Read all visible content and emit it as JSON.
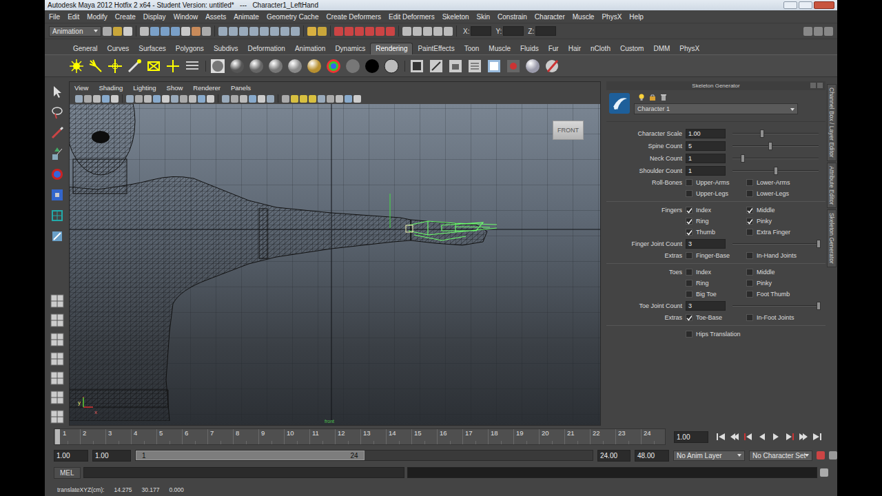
{
  "window": {
    "title": "Autodesk Maya 2012 Hotfix 2 x64 - Student Version: untitled*   ---   Character1_LeftHand"
  },
  "menu": [
    "File",
    "Edit",
    "Modify",
    "Create",
    "Display",
    "Window",
    "Assets",
    "Animate",
    "Geometry Cache",
    "Create Deformers",
    "Edit Deformers",
    "Skeleton",
    "Skin",
    "Constrain",
    "Character",
    "Muscle",
    "PhysX",
    "Help"
  ],
  "status_line": {
    "mode": "Animation",
    "coords": [
      "X:",
      "Y:",
      "Z:"
    ]
  },
  "shelf": {
    "tabs": [
      {
        "label": "General",
        "selected": false
      },
      {
        "label": "Curves",
        "selected": false
      },
      {
        "label": "Surfaces",
        "selected": false
      },
      {
        "label": "Polygons",
        "selected": false
      },
      {
        "label": "Subdivs",
        "selected": false
      },
      {
        "label": "Deformation",
        "selected": false
      },
      {
        "label": "Animation",
        "selected": false
      },
      {
        "label": "Dynamics",
        "selected": false
      },
      {
        "label": "Rendering",
        "selected": true
      },
      {
        "label": "PaintEffects",
        "selected": false
      },
      {
        "label": "Toon",
        "selected": false
      },
      {
        "label": "Muscle",
        "selected": false
      },
      {
        "label": "Fluids",
        "selected": false
      },
      {
        "label": "Fur",
        "selected": false
      },
      {
        "label": "Hair",
        "selected": false
      },
      {
        "label": "nCloth",
        "selected": false
      },
      {
        "label": "Custom",
        "selected": false
      },
      {
        "label": "DMM",
        "selected": false
      },
      {
        "label": "PhysX",
        "selected": false
      }
    ]
  },
  "viewport": {
    "menu": [
      "View",
      "Shading",
      "Lighting",
      "Show",
      "Renderer",
      "Panels"
    ],
    "view_cube": "FRONT",
    "camera": "front",
    "axis_labels": [
      "y",
      "x"
    ]
  },
  "skeleton_generator": {
    "title": "Skeleton Generator",
    "character": "Character 1",
    "rows": [
      {
        "kind": "slider",
        "label": "Character Scale",
        "value": "1.00",
        "level": 0.34
      },
      {
        "kind": "slider",
        "label": "Spine Count",
        "value": "5",
        "level": 0.44
      },
      {
        "kind": "slider",
        "label": "Neck Count",
        "value": "1",
        "level": 0.12
      },
      {
        "kind": "slider",
        "label": "Shoulder Count",
        "value": "1",
        "level": 0.5
      },
      {
        "kind": "checks",
        "label": "Roll-Bones",
        "items": [
          {
            "label": "Upper-Arms",
            "checked": false
          },
          {
            "label": "Lower-Arms",
            "checked": false
          }
        ]
      },
      {
        "kind": "checks",
        "label": "",
        "items": [
          {
            "label": "Upper-Legs",
            "checked": false
          },
          {
            "label": "Lower-Legs",
            "checked": false
          }
        ]
      },
      {
        "kind": "separator"
      },
      {
        "kind": "checks",
        "label": "Fingers",
        "items": [
          {
            "label": "Index",
            "checked": true
          },
          {
            "label": "Middle",
            "checked": true
          }
        ]
      },
      {
        "kind": "checks",
        "label": "",
        "items": [
          {
            "label": "Ring",
            "checked": true
          },
          {
            "label": "Pinky",
            "checked": true
          }
        ]
      },
      {
        "kind": "checks",
        "label": "",
        "items": [
          {
            "label": "Thumb",
            "checked": true
          },
          {
            "label": "Extra Finger",
            "checked": false
          }
        ]
      },
      {
        "kind": "slider",
        "label": "Finger Joint Count",
        "value": "3",
        "level": 1
      },
      {
        "kind": "checks",
        "label": "Extras",
        "items": [
          {
            "label": "Finger-Base",
            "checked": false
          },
          {
            "label": "In-Hand Joints",
            "checked": false
          }
        ]
      },
      {
        "kind": "separator"
      },
      {
        "kind": "checks",
        "label": "Toes",
        "items": [
          {
            "label": "Index",
            "checked": false
          },
          {
            "label": "Middle",
            "checked": false
          }
        ]
      },
      {
        "kind": "checks",
        "label": "",
        "items": [
          {
            "label": "Ring",
            "checked": false
          },
          {
            "label": "Pinky",
            "checked": false
          }
        ]
      },
      {
        "kind": "checks",
        "label": "",
        "items": [
          {
            "label": "Big Toe",
            "checked": false
          },
          {
            "label": "Foot Thumb",
            "checked": false
          }
        ]
      },
      {
        "kind": "slider",
        "label": "Toe Joint Count",
        "value": "3",
        "level": 1
      },
      {
        "kind": "checks",
        "label": "Extras",
        "items": [
          {
            "label": "Toe-Base",
            "checked": true
          },
          {
            "label": "In-Foot Joints",
            "checked": false
          }
        ]
      },
      {
        "kind": "separator"
      },
      {
        "kind": "checks",
        "label": "",
        "items": [
          {
            "label": "Hips Translation",
            "checked": false
          }
        ]
      }
    ]
  },
  "side_tabs": [
    "Channel Box / Layer Editor",
    "Attribute Editor",
    "Skeleton Generator"
  ],
  "time_slider": {
    "ticks": [
      {
        "label": "1",
        "selected": true
      },
      {
        "label": "2",
        "selected": false
      },
      {
        "label": "3",
        "selected": false
      },
      {
        "label": "4",
        "selected": false
      },
      {
        "label": "5",
        "selected": false
      },
      {
        "label": "6",
        "selected": false
      },
      {
        "label": "7",
        "selected": false
      },
      {
        "label": "8",
        "selected": false
      },
      {
        "label": "9",
        "selected": false
      },
      {
        "label": "10",
        "selected": false
      },
      {
        "label": "11",
        "selected": false
      },
      {
        "label": "12",
        "selected": false
      },
      {
        "label": "13",
        "selected": false
      },
      {
        "label": "14",
        "selected": false
      },
      {
        "label": "15",
        "selected": false
      },
      {
        "label": "16",
        "selected": false
      },
      {
        "label": "17",
        "selected": false
      },
      {
        "label": "18",
        "selected": false
      },
      {
        "label": "19",
        "selected": false
      },
      {
        "label": "20",
        "selected": false
      },
      {
        "label": "21",
        "selected": false
      },
      {
        "label": "22",
        "selected": false
      },
      {
        "label": "23",
        "selected": false
      },
      {
        "label": "24",
        "selected": false
      }
    ],
    "current_value": "1.00"
  },
  "range_slider": {
    "start": "1.00",
    "playback_start": "1.00",
    "range_start": "1",
    "range_end": "24",
    "playback_end": "24.00",
    "end": "48.00",
    "level": 0.5,
    "anim_layer": "No Anim Layer",
    "character_set": "No Character Set"
  },
  "command_line": {
    "language": "MEL"
  },
  "help_line": {
    "label": "translateXYZ(cm):",
    "values": [
      "14.275",
      "30.177",
      "0.000"
    ]
  }
}
